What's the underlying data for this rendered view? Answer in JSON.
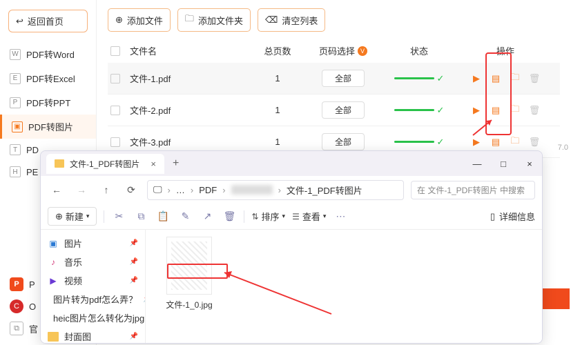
{
  "sidebar": {
    "back_label": "返回首页",
    "items": [
      {
        "icon": "W",
        "label": "PDF转Word"
      },
      {
        "icon": "E",
        "label": "PDF转Excel"
      },
      {
        "icon": "P",
        "label": "PDF转PPT"
      },
      {
        "icon": "▣",
        "label": "PDF转图片"
      },
      {
        "icon": "T",
        "label": "PD"
      },
      {
        "icon": "H",
        "label": "PE"
      }
    ],
    "bottom": {
      "p": "P",
      "c": "C",
      "g": "官"
    }
  },
  "toolbar": {
    "add_file": "添加文件",
    "add_folder": "添加文件夹",
    "clear": "清空列表"
  },
  "table": {
    "headers": {
      "name": "文件名",
      "pages": "总页数",
      "sel": "页码选择",
      "status": "状态",
      "ops": "操作"
    },
    "rows": [
      {
        "name": "文件-1.pdf",
        "pages": "1",
        "sel": "全部"
      },
      {
        "name": "文件-2.pdf",
        "pages": "1",
        "sel": "全部"
      },
      {
        "name": "文件-3.pdf",
        "pages": "1",
        "sel": "全部"
      }
    ]
  },
  "explorer": {
    "tab_title": "文件-1_PDF转图片",
    "breadcrumb": {
      "root": "PDF",
      "leaf": "文件-1_PDF转图片"
    },
    "search_placeholder": "在 文件-1_PDF转图片 中搜索",
    "new_btn": "新建",
    "sort": "排序",
    "view": "查看",
    "details": "详细信息",
    "sidebar": [
      {
        "type": "pic",
        "glyph": "▣",
        "label": "图片",
        "pin": true
      },
      {
        "type": "music",
        "glyph": "♪",
        "label": "音乐",
        "pin": true
      },
      {
        "type": "video",
        "glyph": "▶",
        "label": "视频",
        "pin": true
      },
      {
        "type": "folder",
        "glyph": "",
        "label": "图片转为pdf怎么弄？",
        "pin": true
      },
      {
        "type": "folder",
        "glyph": "",
        "label": "heic图片怎么转化为jpg",
        "pin": true
      },
      {
        "type": "folder",
        "glyph": "",
        "label": "封面图",
        "pin": true
      }
    ],
    "file": {
      "name": "文件-1_0.jpg"
    }
  },
  "version": "7.0"
}
